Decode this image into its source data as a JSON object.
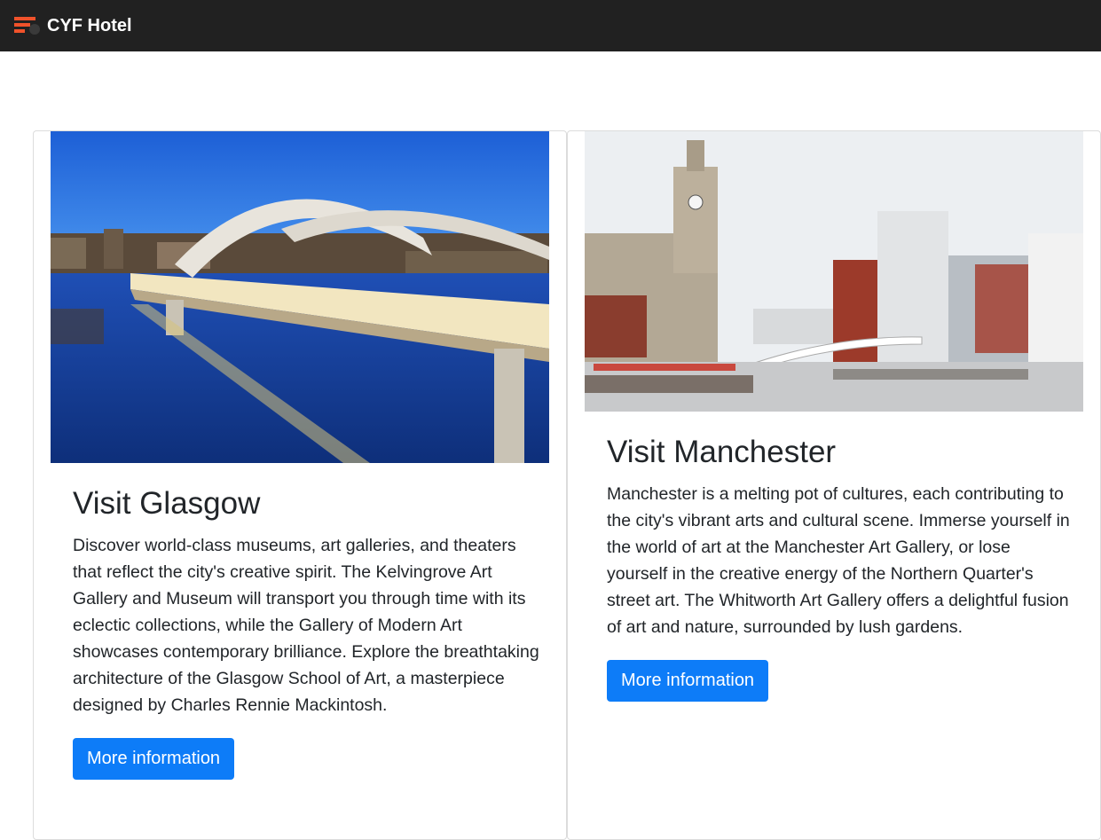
{
  "navbar": {
    "brand_name": "CYF Hotel",
    "logo_icon": "cyf-logo-icon",
    "background": "#212121"
  },
  "cards": [
    {
      "title": "Visit Glasgow",
      "image_icon": "glasgow-bridge-photo",
      "text": "Discover world-class museums, art galleries, and theaters that reflect the city's creative spirit. The Kelvingrove Art Gallery and Museum will transport you through time with its eclectic collections, while the Gallery of Modern Art showcases contemporary brilliance. Explore the breathtaking architecture of the Glasgow School of Art, a masterpiece designed by Charles Rennie Mackintosh.",
      "button_label": "More information"
    },
    {
      "title": "Visit Manchester",
      "image_icon": "liverpool-waterfront-photo",
      "text": "Manchester is a melting pot of cultures, each contributing to the city's vibrant arts and cultural scene. Immerse yourself in the world of art at the Manchester Art Gallery, or lose yourself in the creative energy of the Northern Quarter's street art. The Whitworth Art Gallery offers a delightful fusion of art and nature, surrounded by lush gardens.",
      "button_label": "More information"
    }
  ],
  "colors": {
    "primary_button": "#0d7cf8",
    "accent_logo": "#f0522b"
  }
}
